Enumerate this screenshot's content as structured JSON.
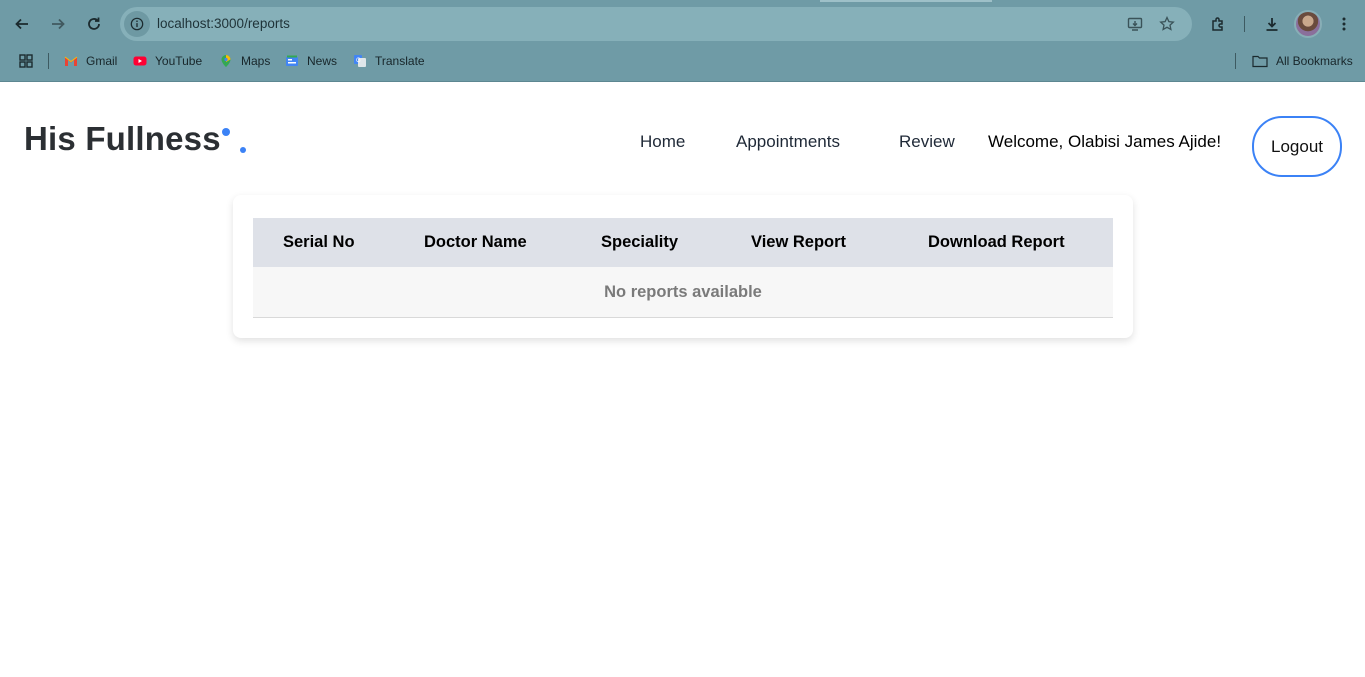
{
  "browser": {
    "url": "localhost:3000/reports",
    "bookmarks": [
      {
        "label": "Gmail",
        "icon": "gmail-icon",
        "color": "#ea4335"
      },
      {
        "label": "YouTube",
        "icon": "youtube-icon",
        "color": "#ff0033"
      },
      {
        "label": "Maps",
        "icon": "maps-icon",
        "color": "#34a853"
      },
      {
        "label": "News",
        "icon": "news-icon",
        "color": "#4285f4"
      },
      {
        "label": "Translate",
        "icon": "translate-icon",
        "color": "#4285f4"
      }
    ],
    "all_bookmarks": "All Bookmarks"
  },
  "navbar": {
    "brand": "His Fullness",
    "links": [
      "Home",
      "Appointments",
      "Review"
    ],
    "welcome": "Welcome, Olabisi James Ajide!",
    "logout": "Logout",
    "accent": "#3b82f6"
  },
  "table": {
    "columns": [
      "Serial No",
      "Doctor Name",
      "Speciality",
      "View Report",
      "Download Report"
    ],
    "empty_message": "No reports available"
  }
}
